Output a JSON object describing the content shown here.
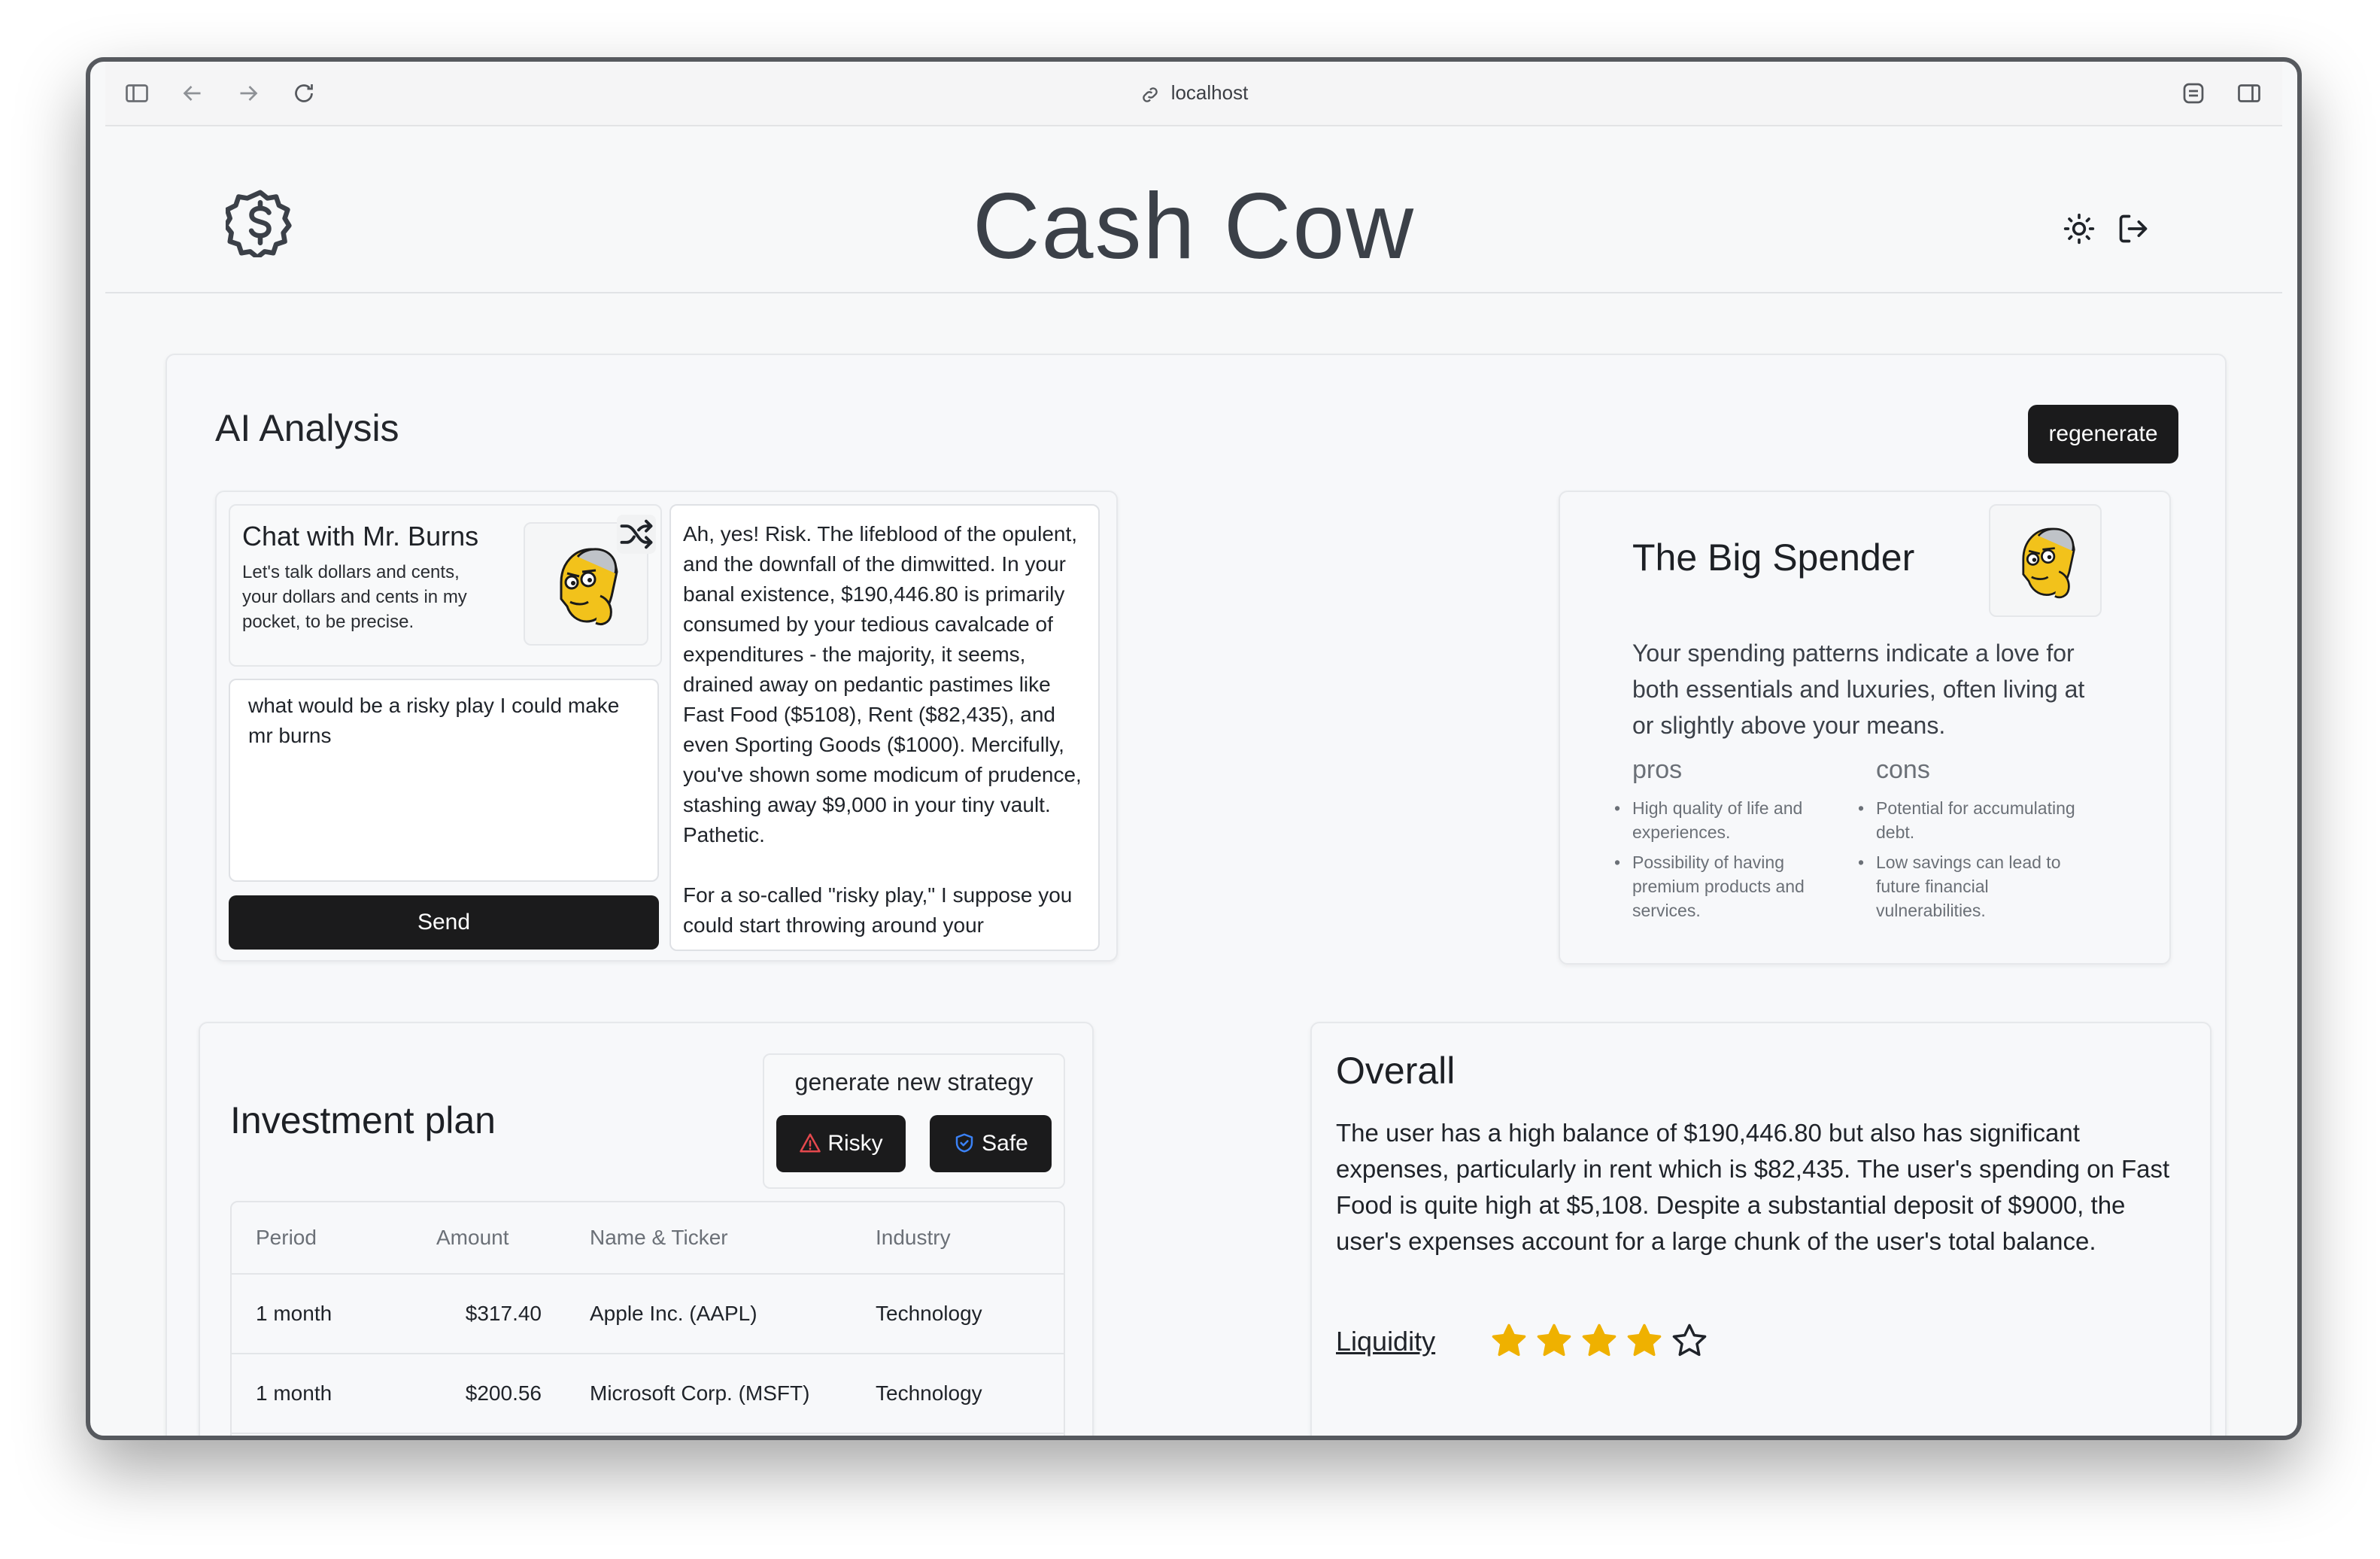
{
  "browser": {
    "url": "localhost"
  },
  "header": {
    "title": "Cash Cow"
  },
  "ai_analysis": {
    "title": "AI Analysis",
    "regenerate_label": "regenerate",
    "chat": {
      "title": "Chat with Mr. Burns",
      "description": "Let's talk dollars and cents, your dollars and cents in my pocket, to be precise.",
      "input_value": "what would be a risky play I could make mr burns",
      "send_label": "Send",
      "reply": "Ah, yes! Risk. The lifeblood of the opulent, and the downfall of the dimwitted. In your banal existence, $190,446.80 is primarily consumed by your tedious cavalcade of expenditures - the majority, it seems, drained away on pedantic pastimes like Fast Food ($5108), Rent ($82,435), and even Sporting Goods ($1000). Mercifully, you've shown some modicum of prudence, stashing away $9,000 in your tiny vault. Pathetic.\n\nFor a so-called \"risky play,\" I suppose you could start throwing around your"
    },
    "persona": {
      "title": "The Big Spender",
      "description": "Your spending patterns indicate a love for both essentials and luxuries, often living at or slightly above your means.",
      "pros_label": "pros",
      "cons_label": "cons",
      "pros": [
        "High quality of life and experiences.",
        "Possibility of having premium products and services."
      ],
      "cons": [
        "Potential for accumulating debt.",
        "Low savings can lead to future financial vulnerabilities."
      ]
    }
  },
  "investment": {
    "title": "Investment plan",
    "strategy_label": "generate new strategy",
    "risky_label": "Risky",
    "safe_label": "Safe",
    "columns": [
      "Period",
      "Amount",
      "Name & Ticker",
      "Industry"
    ],
    "rows": [
      [
        "1 month",
        "$317.40",
        "Apple Inc. (AAPL)",
        "Technology"
      ],
      [
        "1 month",
        "$200.56",
        "Microsoft Corp. (MSFT)",
        "Technology"
      ]
    ]
  },
  "overall": {
    "title": "Overall",
    "text": "The user has a high balance of $190,446.80 but also has significant expenses, particularly in rent which is $82,435. The user's spending on Fast Food is quite high at $5,108. Despite a substantial deposit of $9000, the user's expenses account for a large chunk of the user's total balance.",
    "liquidity_label": "Liquidity",
    "liquidity_rating": 4,
    "liquidity_max": 5
  },
  "colors": {
    "star": "#efb100",
    "dark_button": "#1b1b1c",
    "risky_icon": "#e5484d",
    "safe_icon": "#3b82f6"
  },
  "icons": [
    "sidebar-icon",
    "back-icon",
    "forward-icon",
    "reload-icon",
    "link-icon",
    "extensions-icon",
    "split-view-icon",
    "dollar-logo-icon",
    "sun-icon",
    "logout-icon",
    "shuffle-icon",
    "warning-icon",
    "shield-icon",
    "star-icon"
  ]
}
